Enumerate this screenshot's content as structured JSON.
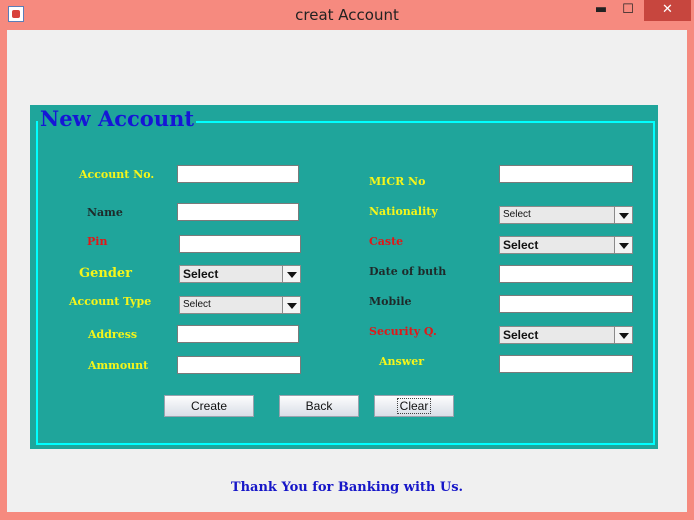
{
  "window": {
    "title": "creat Account",
    "controls": {
      "minimize": "▬",
      "maximize": "☐",
      "close": "✕"
    }
  },
  "panel": {
    "title": "New Account"
  },
  "left_fields": {
    "account_no": {
      "label": "Account No.",
      "value": ""
    },
    "name": {
      "label": "Name",
      "value": ""
    },
    "pin": {
      "label": "Pin",
      "value": ""
    },
    "gender": {
      "label": "Gender",
      "selected": "Select"
    },
    "account_type": {
      "label": "Account Type",
      "selected": "Select"
    },
    "address": {
      "label": "Address",
      "value": ""
    },
    "amount": {
      "label": "Ammount",
      "value": ""
    }
  },
  "right_fields": {
    "micr_no": {
      "label": "MICR No",
      "value": ""
    },
    "nationality": {
      "label": "Nationality",
      "selected": "Select"
    },
    "caste": {
      "label": "Caste",
      "selected": "Select"
    },
    "dob": {
      "label": "Date of buth",
      "value": ""
    },
    "mobile": {
      "label": "Mobile",
      "value": ""
    },
    "security_q": {
      "label": "Security Q.",
      "selected": "Select"
    },
    "answer": {
      "label": "Answer",
      "value": ""
    }
  },
  "buttons": {
    "create": "Create",
    "back": "Back",
    "clear": "Clear"
  },
  "footer": "Thank You for Banking with Us.",
  "colors": {
    "window_frame": "#f68a7f",
    "panel_bg": "#1fa59b",
    "panel_border": "#00ffff",
    "title_blue": "#1616d6",
    "label_yellow": "#f5f51a",
    "label_red": "#e01818"
  }
}
